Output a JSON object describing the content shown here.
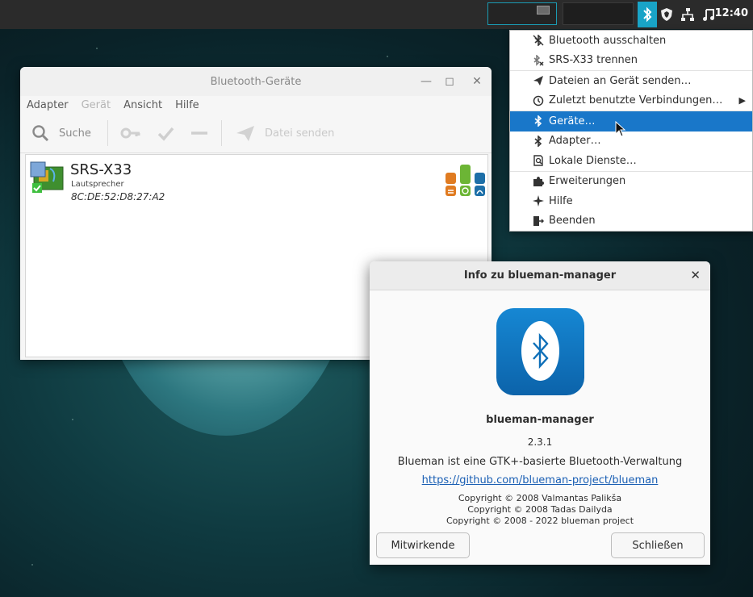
{
  "panel": {
    "clock": "12:40"
  },
  "menu": {
    "items": [
      {
        "label": "Bluetooth ausschalten"
      },
      {
        "label": "SRS-X33 trennen"
      },
      {
        "label": "Dateien an Gerät senden…"
      },
      {
        "label": "Zuletzt benutzte Verbindungen…"
      },
      {
        "label": "Geräte…",
        "highlighted": true
      },
      {
        "label": "Adapter…"
      },
      {
        "label": "Lokale Dienste…"
      },
      {
        "label": "Erweiterungen"
      },
      {
        "label": "Hilfe"
      },
      {
        "label": "Beenden"
      }
    ],
    "highlight_color": "#1977c9"
  },
  "devices_window": {
    "title": "Bluetooth-Geräte",
    "menubar": [
      "Adapter",
      "Gerät",
      "Ansicht",
      "Hilfe"
    ],
    "toolbar": {
      "search": "Suche",
      "send_file": "Datei senden"
    },
    "device": {
      "name": "SRS-X33",
      "type": "Lautsprecher",
      "address": "8C:DE:52:D8:27:A2"
    }
  },
  "about": {
    "title": "Info zu blueman-manager",
    "app_name": "blueman-manager",
    "version": "2.3.1",
    "description": "Blueman ist eine GTK+-basierte Bluetooth-Verwaltung",
    "url": "https://github.com/blueman-project/blueman",
    "copyright1": "Copyright © 2008 Valmantas Palikša",
    "copyright2": "Copyright © 2008 Tadas Dailyda",
    "copyright3": "Copyright © 2008 - 2022 blueman project",
    "credits_button": "Mitwirkende",
    "close_button": "Schließen",
    "icon_color": "#1577c4"
  },
  "accent_color": "#19a4c7"
}
